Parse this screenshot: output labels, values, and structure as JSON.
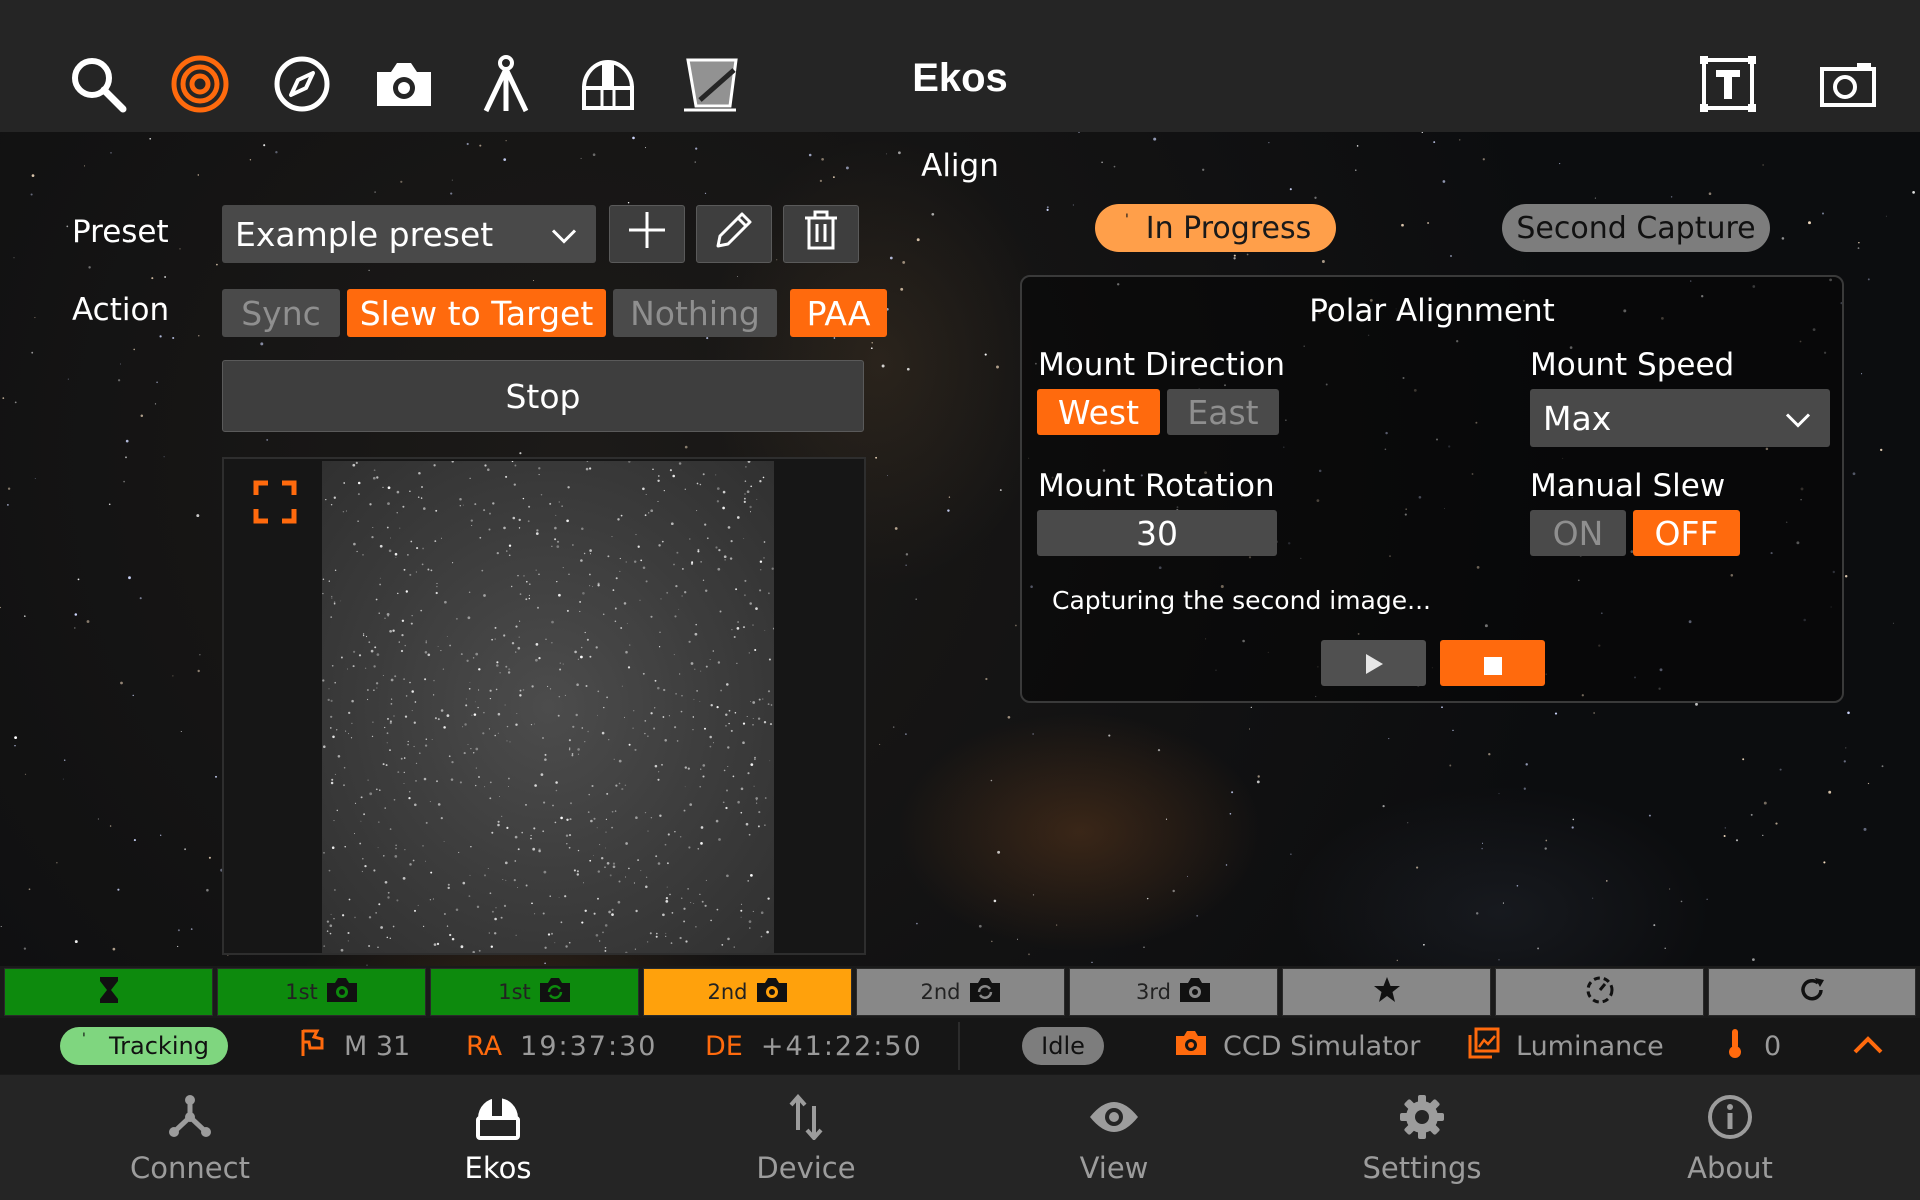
{
  "header": {
    "title": "Ekos",
    "tool_icons": [
      "search-icon",
      "target-icon",
      "compass-icon",
      "camera-icon",
      "tripod-icon",
      "observatory-icon",
      "filter-icon"
    ],
    "right_icons": [
      "text-overlay-icon",
      "screenshot-icon"
    ]
  },
  "page": {
    "title": "Align"
  },
  "preset": {
    "label": "Preset",
    "value": "Example preset",
    "icons": [
      "plus-icon",
      "pencil-icon",
      "trash-icon"
    ]
  },
  "action": {
    "label": "Action",
    "options": [
      {
        "label": "Sync",
        "active": false
      },
      {
        "label": "Slew to Target",
        "active": true
      },
      {
        "label": "Nothing",
        "active": false
      },
      {
        "label": "PAA",
        "active": true
      }
    ],
    "stop_label": "Stop"
  },
  "viewer": {
    "icons": [
      "fullscreen-icon"
    ]
  },
  "status_pills": {
    "progress": "In Progress",
    "stage": "Second Capture"
  },
  "polar": {
    "title": "Polar Alignment",
    "mount_direction": {
      "label": "Mount Direction",
      "options": [
        "West",
        "East"
      ],
      "selected": "West"
    },
    "mount_speed": {
      "label": "Mount Speed",
      "value": "Max"
    },
    "mount_rotation": {
      "label": "Mount Rotation",
      "value": "30"
    },
    "manual_slew": {
      "label": "Manual Slew",
      "options": [
        "ON",
        "OFF"
      ],
      "selected": "OFF"
    },
    "message": "Capturing the second image...",
    "controls": [
      "play-icon",
      "stop-icon"
    ]
  },
  "steps": [
    {
      "label": "",
      "icon": "hourglass-icon",
      "state": "done"
    },
    {
      "label": "1st",
      "icon": "camera-icon",
      "state": "done"
    },
    {
      "label": "1st",
      "icon": "rotate-camera-icon",
      "state": "done"
    },
    {
      "label": "2nd",
      "icon": "camera-icon",
      "state": "active"
    },
    {
      "label": "2nd",
      "icon": "rotate-camera-icon",
      "state": "pending"
    },
    {
      "label": "3rd",
      "icon": "camera-icon",
      "state": "pending"
    },
    {
      "label": "",
      "icon": "star-icon",
      "state": "pending"
    },
    {
      "label": "",
      "icon": "dashed-circle-icon",
      "state": "pending"
    },
    {
      "label": "",
      "icon": "refresh-icon",
      "state": "pending"
    }
  ],
  "statusbar": {
    "mount_status": "Tracking",
    "target_name": "M 31",
    "ra_label": "RA",
    "ra_value": "19:37:30",
    "de_label": "DE",
    "de_value": "+41:22:50",
    "camera_status": "Idle",
    "camera_name": "CCD Simulator",
    "filter_name": "Luminance",
    "temperature": "0"
  },
  "nav": [
    {
      "label": "Connect",
      "icon": "connect-icon"
    },
    {
      "label": "Ekos",
      "icon": "ekos-icon",
      "active": true
    },
    {
      "label": "Device",
      "icon": "device-icon"
    },
    {
      "label": "View",
      "icon": "eye-icon"
    },
    {
      "label": "Settings",
      "icon": "gear-icon"
    },
    {
      "label": "About",
      "icon": "info-icon"
    }
  ],
  "colors": {
    "accent": "#ff6a0d",
    "success": "#0d8a0d",
    "warning": "#ffa10c",
    "tracking": "#7fd67f"
  }
}
